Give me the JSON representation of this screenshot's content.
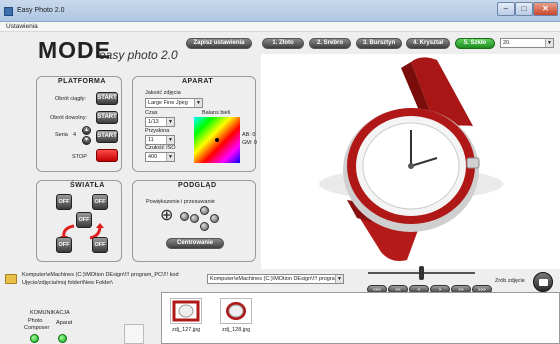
{
  "window": {
    "title": "Easy Photo 2.0",
    "min": "–",
    "max": "□",
    "close": "✕"
  },
  "menu": {
    "item": "Ustawienia"
  },
  "brand": {
    "logo": "MODE",
    "sub": "easy photo 2.0"
  },
  "toolbar": {
    "save_label": "Zapisz ustawienia",
    "presets": [
      {
        "label": "1. Złoto",
        "active": false
      },
      {
        "label": "2. Srebro",
        "active": false
      },
      {
        "label": "3. Bursztyn",
        "active": false
      },
      {
        "label": "4. Kryształ",
        "active": false
      },
      {
        "label": "5. Szkło",
        "active": true
      }
    ],
    "preset_value": "20."
  },
  "platforma": {
    "title": "PLATFORMA",
    "obrot_ciagly": "Obrót ciągły:",
    "obrot_dowolny": "Obrót dowolny:",
    "seria_label": "Seria",
    "seria_value": "4",
    "start": "START",
    "stop": "STOP",
    "up": "▲",
    "down": "▼"
  },
  "aparat": {
    "title": "APARAT",
    "jakosc_label": "Jakość zdjęcia",
    "jakosc_value": "Large Fine Jpeg",
    "czas_label": "Czas",
    "czas_value": "1/13",
    "przyslona_label": "Przysłona",
    "przyslona_value": "11",
    "iso_label": "Czułość ISO",
    "iso_value": "400",
    "balans_label": "Balans bieli",
    "ab": "AB: 0",
    "gm": "GM: 0"
  },
  "swiatla": {
    "title": "ŚWIATŁA",
    "off": "OFF"
  },
  "podglad": {
    "title": "PODGLĄD",
    "sub": "Powiększenie i przesuwanie",
    "center": "Centrowanie",
    "zoom_icon": "⊕"
  },
  "path": {
    "text1": "Komputer\\eMachines (C:)\\MOtion DEsign\\!!! program_PC\\!!! kod",
    "text2": "Ujęcie/zdjęcia/moj folder\\New Folder\\",
    "combo": "Komputer\\eMachines (C:)\\MOtion DEsign\\!!! progran"
  },
  "nav": {
    "buttons": [
      "<<<",
      "<<",
      "<",
      ">",
      ">>",
      ">>>"
    ]
  },
  "capture": {
    "label": "Zrób zdjęcie"
  },
  "komunikacja": {
    "title": "KOMUNIKACJA",
    "photo": "Photo",
    "composer": "Composer",
    "aparat": "Aparat"
  },
  "thumbnails": [
    {
      "label": "zdj_127.jpg"
    },
    {
      "label": "zdj_128.jpg"
    }
  ],
  "colors": {
    "accent_green": "#2aa52a",
    "stop_red": "#d40000",
    "strap_red": "#b01818"
  }
}
